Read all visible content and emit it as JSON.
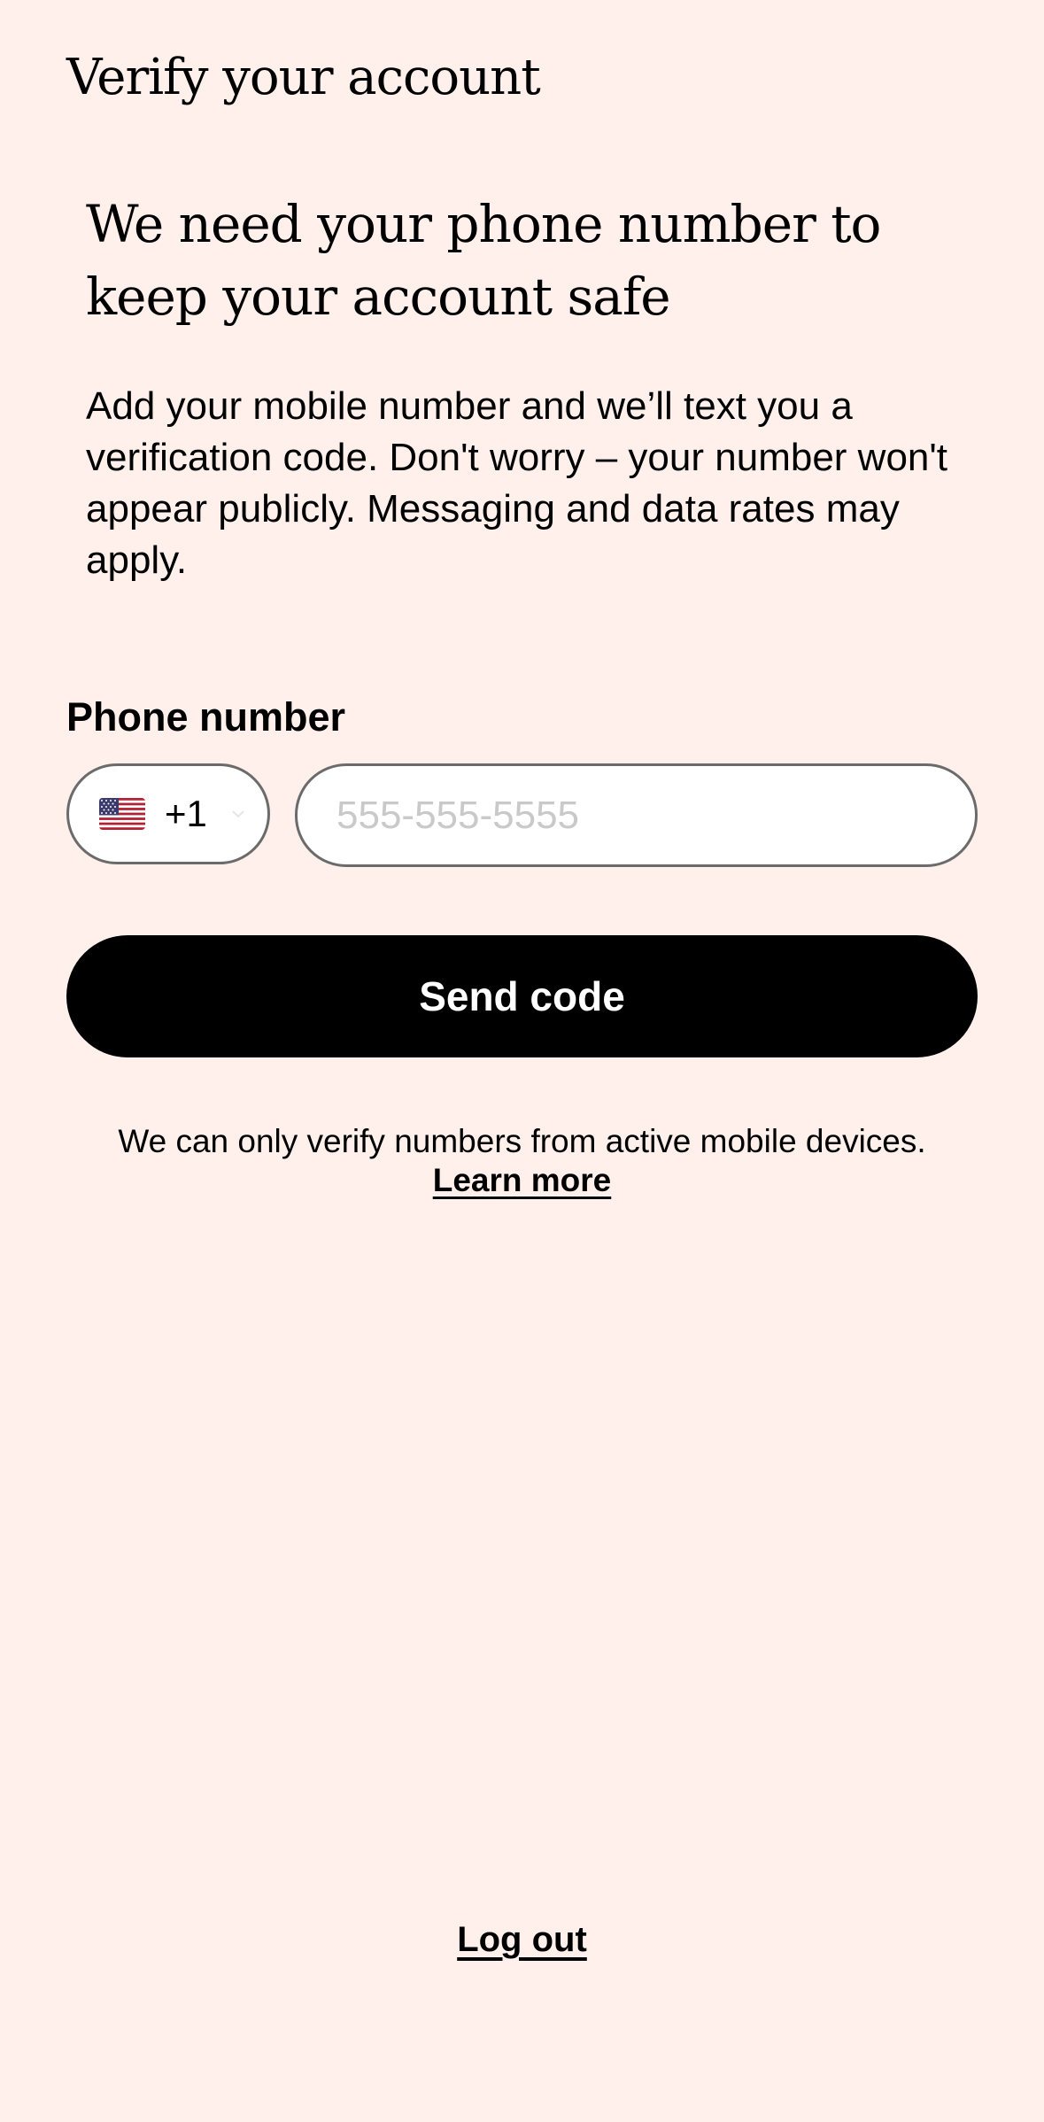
{
  "header": {
    "title": "Verify your account"
  },
  "main": {
    "headline": "We need your phone number to keep your account safe",
    "description": "Add your mobile number and we’ll text you a verification code. Don't worry – your number won't appear publicly. Messaging and data rates may apply.",
    "phone_field": {
      "label": "Phone number",
      "country": {
        "flag": "us-flag-icon",
        "dial_code": "+1"
      },
      "value": "",
      "placeholder": "555-555-5555"
    },
    "send_button_label": "Send code",
    "info_text": "We can only verify numbers from active mobile devices.",
    "learn_more_label": "Learn more"
  },
  "footer": {
    "logout_label": "Log out"
  },
  "colors": {
    "background": "#fff0ec",
    "primary_button": "#000000",
    "input_border": "#6b6b6b",
    "placeholder": "#c9c9c9"
  }
}
